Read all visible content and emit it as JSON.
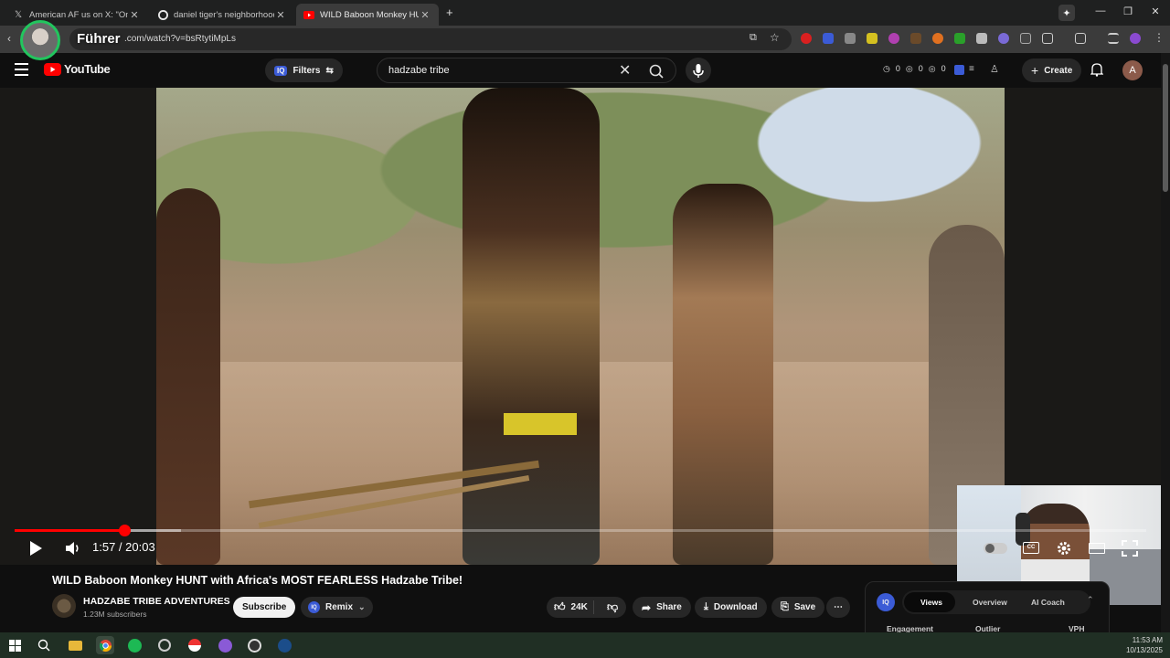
{
  "browser": {
    "tabs": [
      {
        "title": "American AF us on X: \"One of t",
        "favicon": "x-logo-icon",
        "active": false
      },
      {
        "title": "daniel tiger's neighborhood - G",
        "favicon": "google-icon",
        "active": false
      },
      {
        "title": "WILD Baboon Monkey HUNT w",
        "favicon": "youtube-icon",
        "active": true
      }
    ],
    "new_tab_label": "+",
    "url": ".com/watch?v=bsRtytiMpLs"
  },
  "overlay": {
    "name": "Führer"
  },
  "youtube": {
    "logo_text": "YouTube",
    "filters_label": "Filters",
    "filters_badge": "IQ",
    "search_value": "hadzabe tribe",
    "counters": [
      "0",
      "0",
      "0"
    ],
    "create_label": "Create",
    "account_initial": "A"
  },
  "player": {
    "time_display": "1:57 / 20:03",
    "progress": {
      "current_seconds": 117,
      "total_seconds": 1203,
      "buffered_fraction": 0.147
    }
  },
  "video": {
    "title": "WILD Baboon Monkey HUNT with Africa's MOST FEARLESS Hadzabe Tribe!",
    "channel": "HADZABE TRIBE ADVENTURES",
    "subscribers": "1.23M subscribers",
    "subscribe_label": "Subscribe",
    "remix_label": "Remix",
    "remix_badge": "IQ",
    "likes": "24K",
    "share_label": "Share",
    "download_label": "Download",
    "save_label": "Save"
  },
  "iq_panel": {
    "badge": "IQ",
    "tabs": [
      "Views",
      "Overview",
      "AI Coach"
    ],
    "subheaders": [
      "Engagement",
      "Outlier",
      "VPH"
    ]
  },
  "taskbar": {
    "time": "11:53 AM",
    "date": "10/13/2025"
  },
  "colors": {
    "accent": "#ff0000",
    "overlay_ring": "#22c55e"
  }
}
